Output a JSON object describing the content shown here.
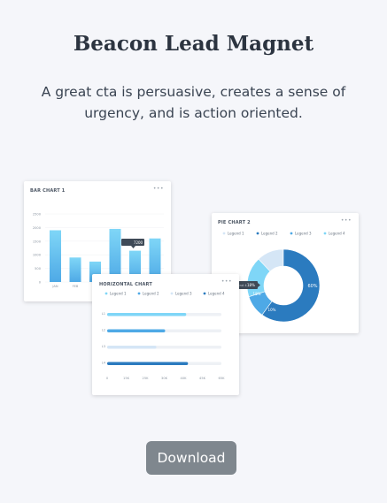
{
  "hero": {
    "title": "Beacon Lead Magnet",
    "subtitle": "A great cta is persuasive, creates a sense of urgency, and is action oriented."
  },
  "cta": {
    "download_label": "Download"
  },
  "colors": {
    "accent_dark": "#2b7bbf",
    "accent_mid": "#4ea9e6",
    "accent_light": "#7fd6f7",
    "accent_pale": "#d5e6f6",
    "button": "#7f878e"
  },
  "bar_chart": {
    "title": "BAR CHART 1",
    "more": "•••",
    "y_ticks": [
      "2500",
      "2000",
      "1500",
      "1000",
      "500",
      "0"
    ],
    "x_labels": [
      "JAN",
      "FEB",
      "",
      "",
      "",
      ""
    ],
    "tooltip": "7200"
  },
  "horizontal_chart": {
    "title": "HORIZONTAL CHART",
    "more": "•••",
    "legend": [
      "Legend 1",
      "Legend 2",
      "Legend 3",
      "Legend 4"
    ],
    "rows": [
      "L1",
      "L2",
      "L3",
      "L4"
    ],
    "x_ticks": [
      "0",
      "15K",
      "25K",
      "30K",
      "40K",
      "45K",
      "65K"
    ]
  },
  "pie_chart": {
    "title": "PIE CHART 2",
    "more": "•••",
    "legend": [
      "Legend 1",
      "Legend 2",
      "Legend 3",
      "Legend 4"
    ],
    "labels": {
      "big": "60%",
      "small": "10%",
      "medium": "18%",
      "tooltip_label": "Legend 4",
      "tooltip_value": "18%"
    }
  },
  "chart_data": [
    {
      "type": "bar",
      "title": "BAR CHART 1",
      "categories": [
        "JAN",
        "FEB",
        "",
        "",
        "",
        ""
      ],
      "values": [
        1900,
        900,
        750,
        1950,
        1150,
        1600
      ],
      "ylim": [
        0,
        2500
      ]
    },
    {
      "type": "bar",
      "title": "HORIZONTAL CHART",
      "categories": [
        "L1",
        "L2",
        "L3",
        "L4"
      ],
      "values": [
        45,
        33,
        28,
        46
      ],
      "series": [
        {
          "name": "Legend 1"
        },
        {
          "name": "Legend 2"
        },
        {
          "name": "Legend 3"
        },
        {
          "name": "Legend 4"
        }
      ]
    },
    {
      "type": "pie",
      "title": "PIE CHART 2",
      "categories": [
        "Legend 1",
        "Legend 2",
        "Legend 3",
        "Legend 4"
      ],
      "values": [
        12,
        60,
        10,
        18
      ]
    }
  ]
}
